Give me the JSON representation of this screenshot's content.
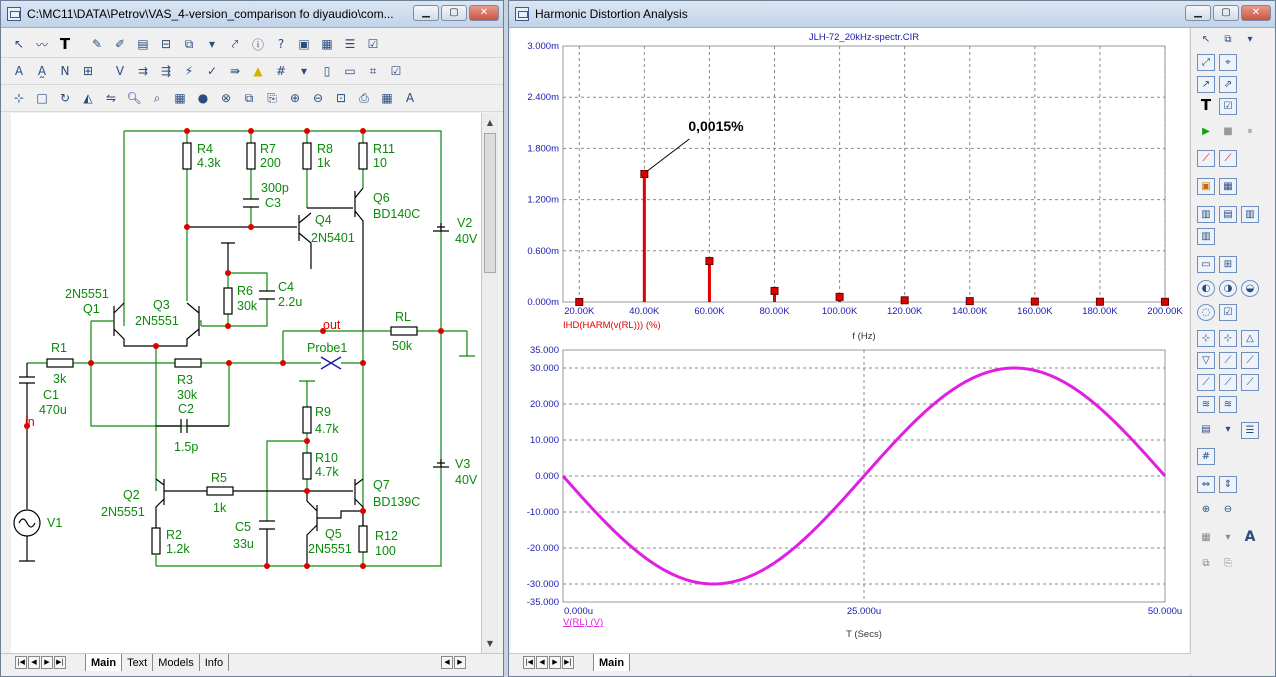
{
  "left_window": {
    "title": "C:\\MC11\\DATA\\Petrov\\VAS_4-version_comparison fo diyaudio\\com...",
    "tabs": [
      {
        "label": "Main"
      },
      {
        "label": "Text"
      },
      {
        "label": "Models"
      },
      {
        "label": "Info"
      }
    ],
    "active_tab": "Main"
  },
  "schematic": {
    "components": {
      "R4": {
        "name": "R4",
        "value": "4.3k"
      },
      "R7": {
        "name": "R7",
        "value": "200"
      },
      "R8": {
        "name": "R8",
        "value": "1k"
      },
      "R11": {
        "name": "R11",
        "value": "10"
      },
      "C3": {
        "name": "C3",
        "value": "300p"
      },
      "Q4": {
        "name": "Q4",
        "value": "2N5401"
      },
      "Q6": {
        "name": "Q6",
        "value": "BD140C"
      },
      "V2": {
        "name": "V2",
        "value": "40V"
      },
      "R6": {
        "name": "R6",
        "value": "30k"
      },
      "C4": {
        "name": "C4",
        "value": "2.2u"
      },
      "Q1": {
        "name": "Q1",
        "value": "2N5551"
      },
      "Q3": {
        "name": "Q3",
        "value": "2N5551"
      },
      "RL": {
        "name": "RL",
        "value": "50k"
      },
      "out": "out",
      "Probe1": "Probe1",
      "R1": {
        "name": "R1",
        "value": "3k"
      },
      "R3": {
        "name": "R3",
        "value": "30k"
      },
      "C2": {
        "name": "C2",
        "value": "1.5p"
      },
      "C1": {
        "name": "C1",
        "value": "470u"
      },
      "in": "in",
      "R9": {
        "name": "R9",
        "value": "4.7k"
      },
      "R10": {
        "name": "R10",
        "value": "4.7k"
      },
      "V3": {
        "name": "V3",
        "value": "40V"
      },
      "Q2": {
        "name": "Q2",
        "value": "2N5551"
      },
      "R5": {
        "name": "R5",
        "value": "1k"
      },
      "Q7": {
        "name": "Q7",
        "value": "BD139C"
      },
      "C5": {
        "name": "C5",
        "value": "33u"
      },
      "Q5": {
        "name": "Q5",
        "value": "2N5551"
      },
      "R12": {
        "name": "R12",
        "value": "100"
      },
      "R2": {
        "name": "R2",
        "value": "1.2k"
      },
      "V1": {
        "name": "V1"
      }
    }
  },
  "right_window": {
    "title": "Harmonic Distortion Analysis",
    "tabs": [
      {
        "label": "Main"
      }
    ],
    "active_tab": "Main"
  },
  "colors": {
    "spectrum": "#e00000",
    "waveform": "#e020e0",
    "axis_text": "#1a1ab0",
    "schematic_wire": "#0b8a0b",
    "node_dot": "#e00000"
  },
  "chart_data": [
    {
      "type": "bar",
      "title": "JLH-72_20kHz-spectr.CIR",
      "xlabel": "f (Hz)",
      "series_label": "IHD(HARM(v(RL))) (%)",
      "annotation": "0,0015%",
      "xlim": [
        15000,
        200000
      ],
      "ylim": [
        0,
        3.0
      ],
      "x_ticks": [
        "20.00K",
        "40.00K",
        "60.00K",
        "80.00K",
        "100.00K",
        "120.00K",
        "140.00K",
        "160.00K",
        "180.00K",
        "200.00K"
      ],
      "y_ticks": [
        "0.000m",
        "0.600m",
        "1.200m",
        "1.800m",
        "2.400m",
        "3.000m"
      ],
      "x": [
        20000,
        40000,
        60000,
        80000,
        100000,
        120000,
        140000,
        160000,
        180000,
        200000
      ],
      "values": [
        0.0,
        1.5,
        0.48,
        0.13,
        0.06,
        0.02,
        0.01,
        0.005,
        0.003,
        0.002
      ]
    },
    {
      "type": "line",
      "xlabel": "T (Secs)",
      "series_label": "V(RL) (V)",
      "xlim": [
        0,
        50
      ],
      "ylim": [
        -35,
        35
      ],
      "x_ticks": [
        "0.000u",
        "25.000u",
        "50.000u"
      ],
      "y_ticks": [
        "35.000",
        "30.000",
        "20.000",
        "10.000",
        "0.000",
        "-10.000",
        "-20.000",
        "-30.000",
        "-35.000"
      ],
      "amplitude": 30,
      "period": 50
    }
  ]
}
